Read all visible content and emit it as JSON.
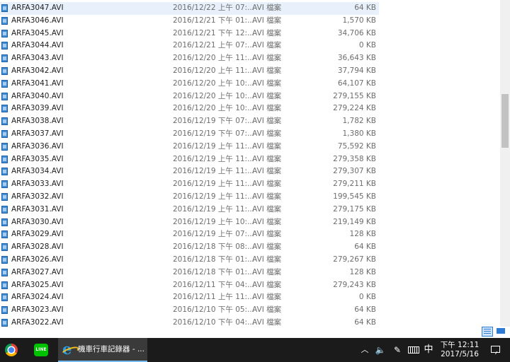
{
  "files": [
    {
      "name": "ARFA3047.AVI",
      "date": "2016/12/22 上午 07:...",
      "type": "AVI 檔案",
      "size": "64 KB"
    },
    {
      "name": "ARFA3046.AVI",
      "date": "2016/12/21 下午 01:...",
      "type": "AVI 檔案",
      "size": "1,570 KB"
    },
    {
      "name": "ARFA3045.AVI",
      "date": "2016/12/21 下午 12:...",
      "type": "AVI 檔案",
      "size": "34,706 KB"
    },
    {
      "name": "ARFA3044.AVI",
      "date": "2016/12/21 上午 07:...",
      "type": "AVI 檔案",
      "size": "0 KB"
    },
    {
      "name": "ARFA3043.AVI",
      "date": "2016/12/20 上午 11:...",
      "type": "AVI 檔案",
      "size": "36,643 KB"
    },
    {
      "name": "ARFA3042.AVI",
      "date": "2016/12/20 上午 11:...",
      "type": "AVI 檔案",
      "size": "37,794 KB"
    },
    {
      "name": "ARFA3041.AVI",
      "date": "2016/12/20 上午 10:...",
      "type": "AVI 檔案",
      "size": "64,107 KB"
    },
    {
      "name": "ARFA3040.AVI",
      "date": "2016/12/20 上午 10:...",
      "type": "AVI 檔案",
      "size": "279,155 KB"
    },
    {
      "name": "ARFA3039.AVI",
      "date": "2016/12/20 上午 10:...",
      "type": "AVI 檔案",
      "size": "279,224 KB"
    },
    {
      "name": "ARFA3038.AVI",
      "date": "2016/12/19 下午 07:...",
      "type": "AVI 檔案",
      "size": "1,782 KB"
    },
    {
      "name": "ARFA3037.AVI",
      "date": "2016/12/19 下午 07:...",
      "type": "AVI 檔案",
      "size": "1,380 KB"
    },
    {
      "name": "ARFA3036.AVI",
      "date": "2016/12/19 上午 11:...",
      "type": "AVI 檔案",
      "size": "75,592 KB"
    },
    {
      "name": "ARFA3035.AVI",
      "date": "2016/12/19 上午 11:...",
      "type": "AVI 檔案",
      "size": "279,358 KB"
    },
    {
      "name": "ARFA3034.AVI",
      "date": "2016/12/19 上午 11:...",
      "type": "AVI 檔案",
      "size": "279,307 KB"
    },
    {
      "name": "ARFA3033.AVI",
      "date": "2016/12/19 上午 11:...",
      "type": "AVI 檔案",
      "size": "279,211 KB"
    },
    {
      "name": "ARFA3032.AVI",
      "date": "2016/12/19 上午 11:...",
      "type": "AVI 檔案",
      "size": "199,545 KB"
    },
    {
      "name": "ARFA3031.AVI",
      "date": "2016/12/19 上午 11:...",
      "type": "AVI 檔案",
      "size": "279,175 KB"
    },
    {
      "name": "ARFA3030.AVI",
      "date": "2016/12/19 上午 10:...",
      "type": "AVI 檔案",
      "size": "219,149 KB"
    },
    {
      "name": "ARFA3029.AVI",
      "date": "2016/12/19 上午 07:...",
      "type": "AVI 檔案",
      "size": "128 KB"
    },
    {
      "name": "ARFA3028.AVI",
      "date": "2016/12/18 下午 08:...",
      "type": "AVI 檔案",
      "size": "64 KB"
    },
    {
      "name": "ARFA3026.AVI",
      "date": "2016/12/18 下午 01:...",
      "type": "AVI 檔案",
      "size": "279,267 KB"
    },
    {
      "name": "ARFA3027.AVI",
      "date": "2016/12/18 下午 01:...",
      "type": "AVI 檔案",
      "size": "128 KB"
    },
    {
      "name": "ARFA3025.AVI",
      "date": "2016/12/11 下午 04:...",
      "type": "AVI 檔案",
      "size": "279,243 KB"
    },
    {
      "name": "ARFA3024.AVI",
      "date": "2016/12/11 上午 11:...",
      "type": "AVI 檔案",
      "size": "0 KB"
    },
    {
      "name": "ARFA3023.AVI",
      "date": "2016/12/10 下午 05:...",
      "type": "AVI 檔案",
      "size": "64 KB"
    },
    {
      "name": "ARFA3022.AVI",
      "date": "2016/12/10 下午 04:...",
      "type": "AVI 檔案",
      "size": "64 KB"
    }
  ],
  "taskbar": {
    "ie_window_label": "機車行車記錄器 - ...",
    "line_label": "LINE",
    "ime": "中",
    "clock_time": "下午 12:11",
    "clock_date": "2017/5/16"
  },
  "icons": {
    "file": "avi-file-icon",
    "chrome": "chrome-icon",
    "line": "line-icon",
    "ie": "internet-explorer-icon",
    "tray": [
      "chevron-up-icon",
      "speaker-icon",
      "pen-icon",
      "keyboard-icon",
      "notification-icon"
    ]
  },
  "colors": {
    "selection": "#e8f1fb",
    "taskbar": "#1b1b1b",
    "accent": "#76b9ed"
  }
}
